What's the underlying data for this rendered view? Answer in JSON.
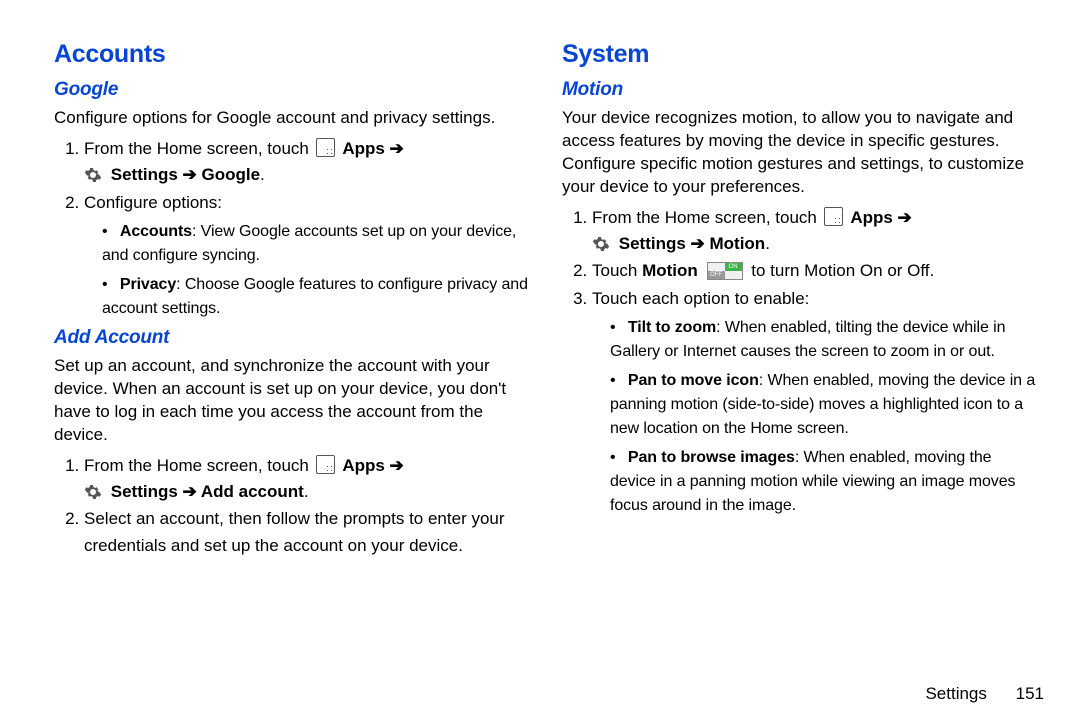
{
  "left": {
    "h1": "Accounts",
    "google": {
      "h2": "Google",
      "lead": "Configure options for Google account and privacy settings.",
      "step1_pre": "From the Home screen, touch ",
      "apps_label": "Apps",
      "arrow": " ➔",
      "settings_path": "Settings ➔ Google",
      "step2": "Configure options:",
      "bullets": {
        "accounts_label": "Accounts",
        "accounts_text": ": View Google accounts set up on your device, and configure syncing.",
        "privacy_label": "Privacy",
        "privacy_text": ": Choose Google features to configure privacy and account settings."
      }
    },
    "add": {
      "h2": "Add Account",
      "lead": "Set up an account, and synchronize the account with your device. When an account is set up on your device, you don't have to log in each time you access the account from the device.",
      "step1_pre": "From the Home screen, touch ",
      "apps_label": "Apps",
      "arrow": " ➔",
      "settings_path": "Settings ➔ Add account",
      "step2": "Select an account, then follow the prompts to enter your credentials and set up the account on your device."
    }
  },
  "right": {
    "h1": "System",
    "motion": {
      "h2": "Motion",
      "lead": "Your device recognizes motion, to allow you to navigate and access features by moving the device in specific gestures. Configure specific motion gestures and settings, to customize your device to your preferences.",
      "step1_pre": "From the Home screen, touch ",
      "apps_label": "Apps",
      "arrow": " ➔",
      "settings_path": "Settings ➔ Motion",
      "step2_pre": "Touch ",
      "step2_b": "Motion",
      "step2_post": " to turn Motion On or Off.",
      "step3": "Touch each option to enable:",
      "bullets": {
        "tilt_label": "Tilt to zoom",
        "tilt_text": ": When enabled, tilting the device while in Gallery or Internet causes the screen to zoom in or out.",
        "pan_icon_label": "Pan to move icon",
        "pan_icon_text": ": When enabled, moving the device in a panning motion (side-to-side) moves a highlighted icon to a new location on the Home screen.",
        "pan_img_label": "Pan to browse images",
        "pan_img_text": ": When enabled, moving the device in a panning motion while viewing an image moves focus around in the image."
      }
    }
  },
  "footer": {
    "section": "Settings",
    "page": "151"
  }
}
